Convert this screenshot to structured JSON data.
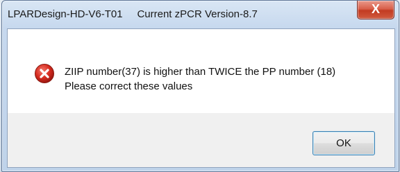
{
  "window": {
    "title": "LPARDesign-HD-V6-T01     Current zPCR Version-8.7",
    "close_label": "X"
  },
  "dialog": {
    "icon": "error-icon",
    "message_line1": "ZIIP number(37) is higher than TWICE the PP number (18)",
    "message_line2": "Please correct these values"
  },
  "buttons": {
    "ok_label": "OK"
  },
  "colors": {
    "close_button": "#c8412a",
    "error_icon": "#d62b1f",
    "ok_focus_border": "#3c7fb1"
  }
}
